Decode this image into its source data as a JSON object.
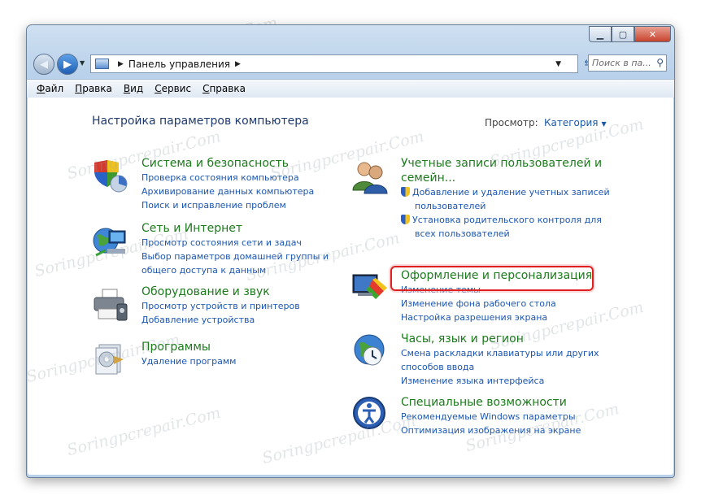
{
  "window": {
    "address_path": [
      "Панель управления"
    ],
    "search_placeholder": "Поиск в панели управления",
    "search_display": "Поиск в па..."
  },
  "menu": [
    "Файл",
    "Правка",
    "Вид",
    "Сервис",
    "Справка"
  ],
  "page": {
    "heading": "Настройка параметров компьютера",
    "view_label": "Просмотр:",
    "view_value": "Категория"
  },
  "left_categories": [
    {
      "icon": "security-shield-icon",
      "title": "Система и безопасность",
      "links": [
        "Проверка состояния компьютера",
        "Архивирование данных компьютера",
        "Поиск и исправление проблем"
      ]
    },
    {
      "icon": "network-globe-icon",
      "title": "Сеть и Интернет",
      "links": [
        "Просмотр состояния сети и задач",
        "Выбор параметров домашней группы и",
        "общего доступа к данным"
      ]
    },
    {
      "icon": "printer-icon",
      "title": "Оборудование и звук",
      "links": [
        "Просмотр устройств и принтеров",
        "Добавление устройства"
      ]
    },
    {
      "icon": "programs-box-icon",
      "title": "Программы",
      "links": [
        "Удаление программ"
      ]
    }
  ],
  "right_categories": [
    {
      "icon": "users-icon",
      "title_lines": [
        "Учетные записи пользователей и",
        "семейн..."
      ],
      "links": [
        [
          "Добавление и удаление учетных записей",
          "пользователей"
        ],
        [
          "Установка родительского контроля для",
          "всех пользователей"
        ]
      ]
    },
    {
      "icon": "appearance-icon",
      "title": "Оформление и персонализация",
      "links": [
        "Изменение темы",
        "Изменение фона рабочего стола",
        "Настройка разрешения экрана"
      ]
    },
    {
      "icon": "clock-globe-icon",
      "title": "Часы, язык и регион",
      "links": [
        "Смена раскладки клавиатуры или других",
        "способов ввода",
        "Изменение языка интерфейса"
      ]
    },
    {
      "icon": "accessibility-icon",
      "title": "Специальные возможности",
      "links": [
        "Рекомендуемые Windows параметры",
        "Оптимизация изображения на экране"
      ]
    }
  ],
  "watermark": "Soringpcrepair.Com",
  "colors": {
    "link": "#1b56b0",
    "category_title": "#1c7a1c",
    "heading": "#1e3a6e",
    "highlight": "#e02020"
  }
}
